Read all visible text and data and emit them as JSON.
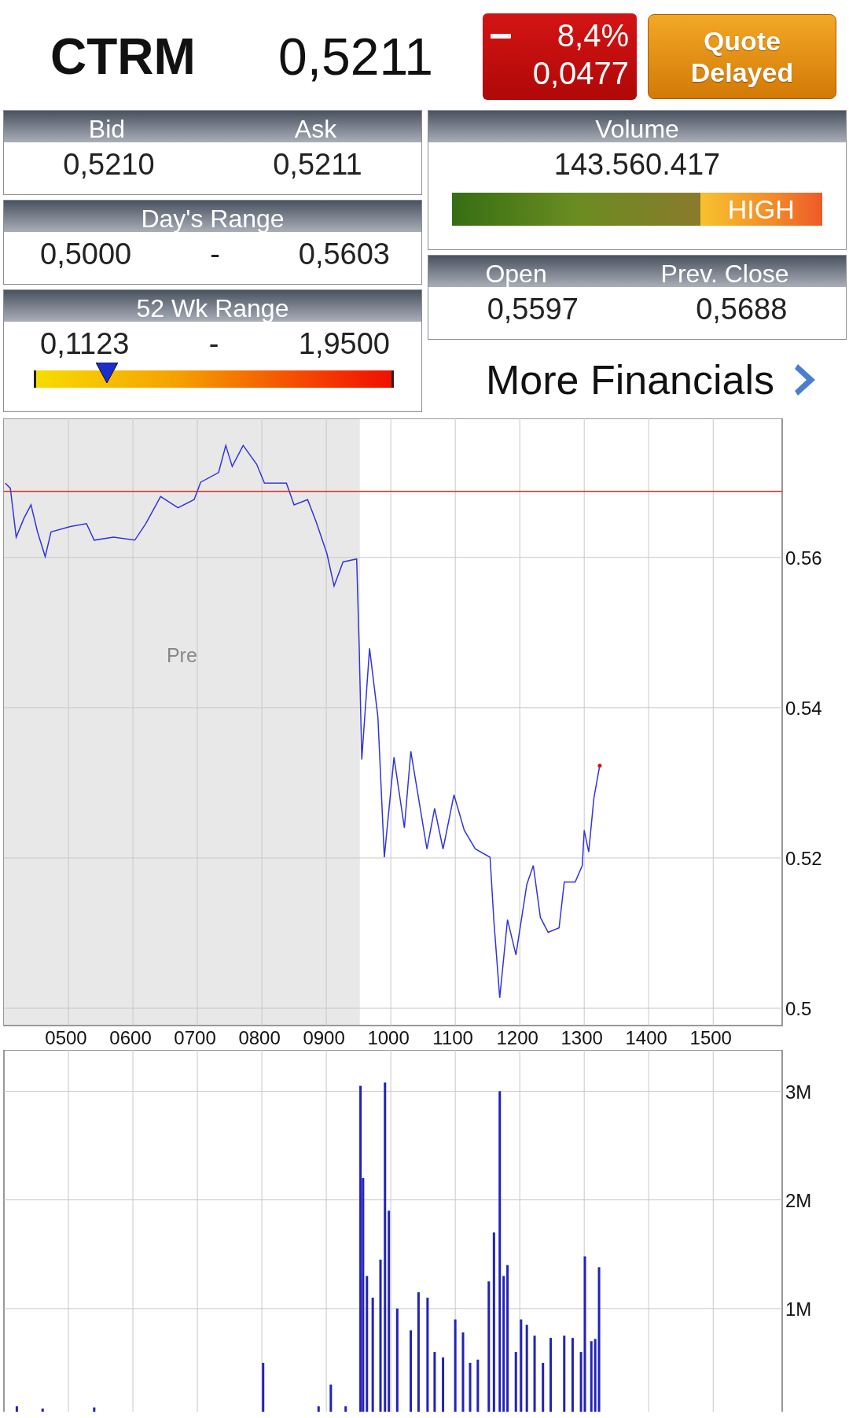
{
  "quote": {
    "symbol": "CTRM",
    "price": "0,5211",
    "change": {
      "negative": true,
      "percent": "8,4%",
      "amount": "0,0477"
    },
    "delay_badge": "Quote Delayed"
  },
  "panels": {
    "bid_ask": {
      "labels": [
        "Bid",
        "Ask"
      ],
      "values": [
        "0,5210",
        "0,5211"
      ]
    },
    "days_range": {
      "label": "Day's Range",
      "low": "0,5000",
      "separator": "-",
      "high": "0,5603"
    },
    "week52_range": {
      "label": "52 Wk Range",
      "low": "0,1123",
      "separator": "-",
      "high": "1,9500",
      "level": 0.2
    },
    "volume": {
      "label": "Volume",
      "value": "143.560.417",
      "meter_label": "HIGH"
    },
    "open_close": {
      "labels": [
        "Open",
        "Prev. Close"
      ],
      "values": [
        "0,5597",
        "0,5688"
      ]
    }
  },
  "more_financials": {
    "label": "More Financials"
  },
  "price_chart": {
    "session_label": "Pre",
    "chart_data": {
      "type": "line",
      "grid": true,
      "xlim": [
        400,
        1607
      ],
      "ylim": [
        0.4977,
        0.5785
      ],
      "xticks": [
        {
          "value": 500,
          "label": "0500"
        },
        {
          "value": 600,
          "label": "0600"
        },
        {
          "value": 700,
          "label": "0700"
        },
        {
          "value": 800,
          "label": "0800"
        },
        {
          "value": 900,
          "label": "0900"
        },
        {
          "value": 1000,
          "label": "1000"
        },
        {
          "value": 1100,
          "label": "1100"
        },
        {
          "value": 1200,
          "label": "1200"
        },
        {
          "value": 1300,
          "label": "1300"
        },
        {
          "value": 1400,
          "label": "1400"
        },
        {
          "value": 1500,
          "label": "1500"
        }
      ],
      "yticks": [
        {
          "value": 0.5,
          "label": "0.5"
        },
        {
          "value": 0.52,
          "label": "0.52"
        },
        {
          "value": 0.54,
          "label": "0.54"
        },
        {
          "value": 0.56,
          "label": "0.56"
        }
      ],
      "x": [
        400,
        402,
        410,
        419,
        431,
        442,
        452,
        464,
        473,
        503,
        528,
        540,
        570,
        603,
        620,
        643,
        670,
        695,
        705,
        733,
        744,
        754,
        771,
        792,
        804,
        838,
        850,
        871,
        884,
        901,
        912,
        926,
        947,
        951,
        955,
        967,
        980,
        990,
        1005,
        1021,
        1031,
        1056,
        1068,
        1081,
        1098,
        1114,
        1131,
        1154,
        1160,
        1169,
        1181,
        1194,
        1211,
        1221,
        1232,
        1244,
        1261,
        1269,
        1286,
        1297,
        1300,
        1307,
        1315,
        1324,
        1607
      ],
      "series": [
        {
          "color": "#3333dd",
          "values": [
            null,
            0.5699,
            0.5692,
            0.5627,
            0.5652,
            0.567,
            0.5634,
            0.5601,
            0.5634,
            0.5641,
            0.5645,
            0.5623,
            0.5627,
            0.5623,
            0.5645,
            0.5681,
            0.5666,
            0.5677,
            0.57,
            0.5713,
            0.5749,
            0.5721,
            0.5749,
            0.5724,
            0.5699,
            0.5699,
            0.567,
            0.5677,
            0.5648,
            0.5605,
            0.5562,
            0.5594,
            0.5598,
            0.5482,
            0.5331,
            0.5479,
            0.5388,
            0.5201,
            0.5334,
            0.524,
            0.5342,
            0.5212,
            0.5266,
            0.5212,
            0.5284,
            0.5237,
            0.5212,
            0.5201,
            0.5114,
            0.5014,
            0.5118,
            0.5071,
            0.5165,
            0.519,
            0.5121,
            0.5101,
            0.5107,
            0.5168,
            0.5168,
            0.519,
            0.5237,
            0.5208,
            0.528,
            0.5323,
            null
          ]
        },
        {
          "color": "#dd2222",
          "values": [
            0.5688,
            0.5688,
            0.5688,
            0.5688,
            0.5688,
            0.5688,
            0.5688,
            0.5688,
            0.5688,
            0.5688,
            0.5688,
            0.5688,
            0.5688,
            0.5688,
            0.5688,
            0.5688,
            0.5688,
            0.5688,
            0.5688,
            0.5688,
            0.5688,
            0.5688,
            0.5688,
            0.5688,
            0.5688,
            0.5688,
            0.5688,
            0.5688,
            0.5688,
            0.5688,
            0.5688,
            0.5688,
            0.5688,
            0.5688,
            0.5688,
            0.5688,
            0.5688,
            0.5688,
            0.5688,
            0.5688,
            0.5688,
            0.5688,
            0.5688,
            0.5688,
            0.5688,
            0.5688,
            0.5688,
            0.5688,
            0.5688,
            0.5688,
            0.5688,
            0.5688,
            0.5688,
            0.5688,
            0.5688,
            0.5688,
            0.5688,
            0.5688,
            0.5688,
            0.5688,
            0.5688,
            0.5688,
            0.5688,
            0.5688,
            0.5688
          ]
        }
      ]
    }
  },
  "volume_chart": {
    "chart_data": {
      "type": "bar",
      "grid": true,
      "xlim": [
        400,
        1607
      ],
      "ylim": [
        0,
        3.38
      ],
      "yticks": [
        {
          "value": 1,
          "label": "1M"
        },
        {
          "value": 2,
          "label": "2M"
        },
        {
          "value": 3,
          "label": "3M"
        }
      ],
      "x": [
        420,
        460,
        540,
        802,
        888,
        907,
        930,
        953,
        957,
        963,
        972,
        984,
        991,
        997,
        1010,
        1031,
        1043,
        1057,
        1068,
        1081,
        1100,
        1112,
        1123,
        1135,
        1152,
        1160,
        1169,
        1175,
        1181,
        1194,
        1202,
        1211,
        1223,
        1236,
        1248,
        1269,
        1282,
        1295,
        1301,
        1311,
        1317,
        1323
      ],
      "series": [
        {
          "color": "#2222bb",
          "values": [
            0.1,
            0.08,
            0.09,
            0.5,
            0.1,
            0.3,
            0.1,
            3.05,
            2.2,
            1.3,
            1.1,
            1.45,
            3.08,
            1.9,
            1.0,
            0.8,
            1.15,
            1.1,
            0.6,
            0.55,
            0.9,
            0.78,
            0.5,
            0.53,
            1.25,
            1.7,
            3.0,
            1.3,
            1.4,
            0.6,
            0.9,
            0.85,
            0.75,
            0.5,
            0.73,
            0.75,
            0.73,
            0.6,
            1.48,
            0.7,
            0.72,
            1.38
          ]
        }
      ]
    }
  }
}
